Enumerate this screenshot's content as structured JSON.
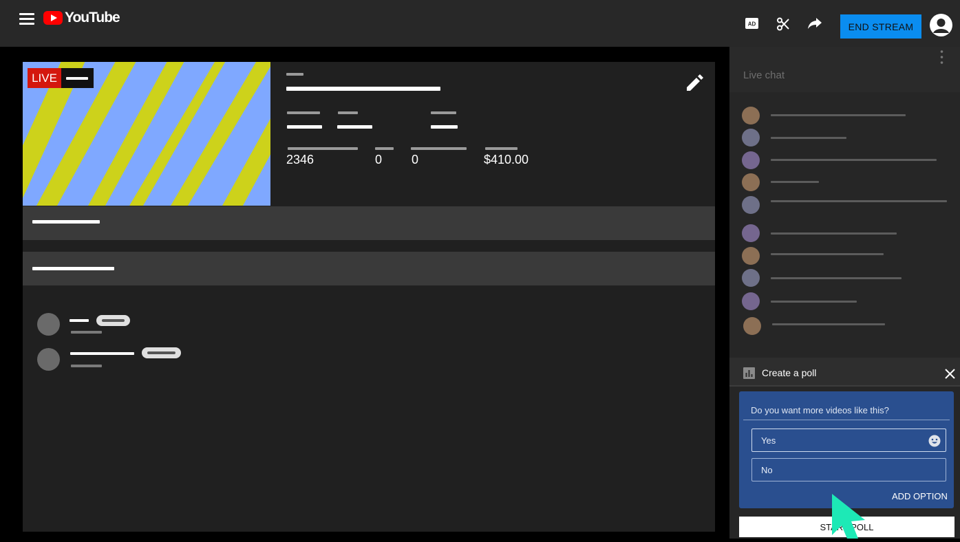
{
  "app": {
    "logo_text": "YouTube"
  },
  "header": {
    "end_stream_label": "END STREAM",
    "icons": [
      "menu-icon",
      "youtube-logo-icon",
      "ad-icon",
      "scissors-icon",
      "share-icon",
      "account-icon"
    ]
  },
  "stream": {
    "live_label": "LIVE",
    "stats": [
      {
        "value": "2346"
      },
      {
        "value": "0"
      },
      {
        "value": "0"
      },
      {
        "value": "$410.00"
      }
    ],
    "edit_icon": "pencil-icon"
  },
  "chat": {
    "title": "Live chat",
    "more_icon": "vertical-dots-icon",
    "avatar_colors": [
      "#8c6f55",
      "#6e7088",
      "#75668f",
      "#8c6f55",
      "#6e7088",
      "#75668f",
      "#8c6f55",
      "#6e7088",
      "#75668f",
      "#8c6f55"
    ]
  },
  "poll": {
    "title": "Create a poll",
    "question": "Do you want more videos like this?",
    "options": [
      {
        "value": "Yes"
      },
      {
        "value": "No"
      }
    ],
    "add_option_label": "ADD OPTION",
    "start_poll_label": "START POLL"
  },
  "colors": {
    "accent_blue": "#0a8df0",
    "live_red": "#d4170e",
    "poll_card": "#2a4f8f",
    "cursor": "#1de9b6",
    "thumb_blue": "#7fa8ff",
    "thumb_yellow": "#cdd21b"
  }
}
